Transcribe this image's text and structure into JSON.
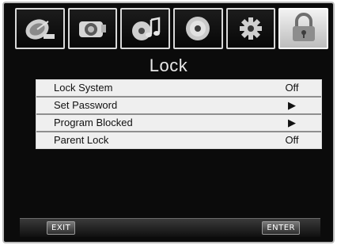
{
  "tabs": [
    {
      "icon": "satellite-dish-icon",
      "active": false
    },
    {
      "icon": "camera-icon",
      "active": false
    },
    {
      "icon": "music-disc-icon",
      "active": false
    },
    {
      "icon": "disc-icon",
      "active": false
    },
    {
      "icon": "gear-icon",
      "active": false
    },
    {
      "icon": "padlock-icon",
      "active": true
    }
  ],
  "title": "Lock",
  "menu": {
    "items": [
      {
        "label": "Lock System",
        "value": "Off"
      },
      {
        "label": "Set Password",
        "value": "▶"
      },
      {
        "label": "Program Blocked",
        "value": "▶"
      },
      {
        "label": "Parent Lock",
        "value": "Off"
      }
    ]
  },
  "footer": {
    "exit_label": "EXIT",
    "enter_label": "ENTER"
  }
}
